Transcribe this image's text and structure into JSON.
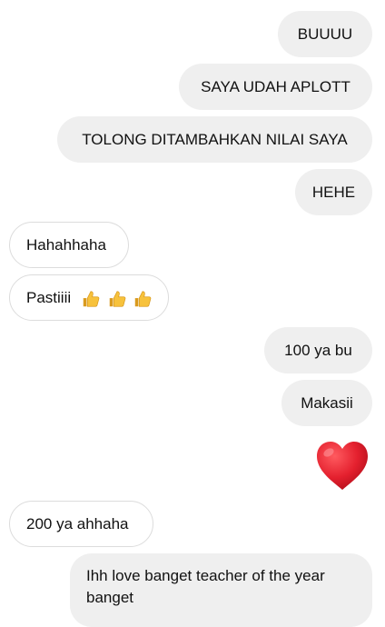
{
  "messages": [
    {
      "sender": "me",
      "text": "BUUUU"
    },
    {
      "sender": "me",
      "text": "SAYA UDAH APLOTT"
    },
    {
      "sender": "me",
      "text": "TOLONG DITAMBAHKAN NILAI SAYA"
    },
    {
      "sender": "me",
      "text": "HEHE"
    },
    {
      "sender": "other",
      "text": "Hahahhaha"
    },
    {
      "sender": "other",
      "text": "Pastiiii",
      "emoji": [
        "thumbs-up-icon",
        "thumbs-up-icon",
        "thumbs-up-icon"
      ]
    },
    {
      "sender": "me",
      "text": "100 ya bu"
    },
    {
      "sender": "me",
      "text": "Makasii"
    },
    {
      "sender": "me",
      "text": "",
      "emoji": [
        "red-heart-icon"
      ]
    },
    {
      "sender": "other",
      "text": "200 ya ahhaha"
    },
    {
      "sender": "me",
      "text": "Ihh love banget teacher of the year banget"
    }
  ],
  "colors": {
    "sent_bubble": "#efefef",
    "received_border": "#dcdcdc",
    "heart": "#e4202e",
    "thumb": "#f7c23c"
  }
}
